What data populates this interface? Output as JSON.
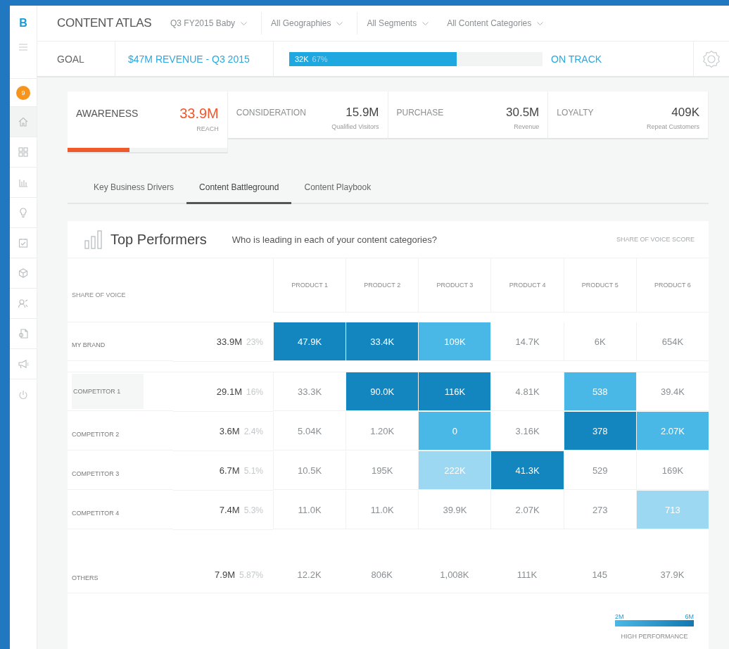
{
  "sidebar": {
    "logo": "B",
    "badge": "9",
    "nav": [
      {
        "selected": true
      },
      {
        "selected": false
      },
      {
        "selected": false
      },
      {
        "selected": false
      },
      {
        "selected": false
      },
      {
        "selected": false
      },
      {
        "selected": false
      },
      {
        "selected": false
      },
      {
        "selected": false
      }
    ]
  },
  "header": {
    "title": "CONTENT ATLAS",
    "filters": [
      {
        "label": "Q3 FY2015 Baby"
      },
      {
        "label": "All Geographies"
      },
      {
        "label": "All Segments"
      },
      {
        "label": "All Content Categories"
      }
    ]
  },
  "goal": {
    "label": "GOAL",
    "target": "$47M REVENUE - Q3 2015",
    "progress_value": "32K",
    "progress_percent": "67%",
    "level": 0.66,
    "status": "ON TRACK"
  },
  "metrics": [
    {
      "name": "AWARENESS",
      "value": "33.9M",
      "caption": "REACH",
      "selected": true,
      "level": 0.39
    },
    {
      "name": "CONSIDERATION",
      "value": "15.9M",
      "caption": "Qualified Visitors",
      "selected": false
    },
    {
      "name": "PURCHASE",
      "value": "30.5M",
      "caption": "Revenue",
      "selected": false
    },
    {
      "name": "LOYALTY",
      "value": "409K",
      "caption": "Repeat Customers",
      "selected": false
    }
  ],
  "tabs": [
    {
      "label": "Key Business Drivers",
      "selected": false
    },
    {
      "label": "Content Battleground",
      "selected": true
    },
    {
      "label": "Content Playbook",
      "selected": false
    }
  ],
  "panel": {
    "title": "Top Performers",
    "question": "Who is leading in each of your content categories?",
    "score_label": "SHARE OF VOICE SCORE"
  },
  "table": {
    "header": "SHARE OF VOICE",
    "columns": [
      "PRODUCT 1",
      "PRODUCT 2",
      "PRODUCT 3",
      "PRODUCT 4",
      "PRODUCT 5",
      "PRODUCT 6"
    ],
    "rows": [
      {
        "name": "MY BRAND",
        "total": "33.9M",
        "share": "23%",
        "selected": false,
        "cells": [
          {
            "value": "47.9K",
            "color": "#1386c0"
          },
          {
            "value": "33.4K",
            "color": "#1386c0"
          },
          {
            "value": "109K",
            "color": "#4ab8e6"
          },
          {
            "value": "14.7K"
          },
          {
            "value": "6K"
          },
          {
            "value": "654K"
          }
        ]
      },
      {
        "name": "COMPETITOR 1",
        "total": "29.1M",
        "share": "16%",
        "selected": true,
        "cells": [
          {
            "value": "33.3K"
          },
          {
            "value": "90.0K",
            "color": "#1386c0"
          },
          {
            "value": "116K",
            "color": "#1386c0"
          },
          {
            "value": "4.81K"
          },
          {
            "value": "538",
            "color": "#4ab8e6"
          },
          {
            "value": "39.4K"
          }
        ]
      },
      {
        "name": "COMPETITOR 2",
        "total": "3.6M",
        "share": "2.4%",
        "selected": false,
        "cells": [
          {
            "value": "5.04K"
          },
          {
            "value": "1.20K"
          },
          {
            "value": "0",
            "color": "#4ab8e6"
          },
          {
            "value": "3.16K"
          },
          {
            "value": "378",
            "color": "#1386c0"
          },
          {
            "value": "2.07K",
            "color": "#4ab8e6"
          }
        ]
      },
      {
        "name": "COMPETITOR 3",
        "total": "6.7M",
        "share": "5.1%",
        "selected": false,
        "cells": [
          {
            "value": "10.5K"
          },
          {
            "value": "195K"
          },
          {
            "value": "222K",
            "color": "#9dd8f2"
          },
          {
            "value": "41.3K",
            "color": "#1386c0"
          },
          {
            "value": "529"
          },
          {
            "value": "169K"
          }
        ]
      },
      {
        "name": "COMPETITOR 4",
        "total": "7.4M",
        "share": "5.3%",
        "selected": false,
        "cells": [
          {
            "value": "11.0K"
          },
          {
            "value": "11.0K"
          },
          {
            "value": "39.9K"
          },
          {
            "value": "2.07K"
          },
          {
            "value": "273"
          },
          {
            "value": "713",
            "color": "#9dd8f2"
          }
        ]
      },
      {
        "name": "OTHERS",
        "total": "7.9M",
        "share": "5.87%",
        "selected": false,
        "cells": [
          {
            "value": "12.2K"
          },
          {
            "value": "806K"
          },
          {
            "value": "1,008K"
          },
          {
            "value": "111K"
          },
          {
            "value": "145"
          },
          {
            "value": "37.9K"
          }
        ]
      }
    ]
  },
  "legend": {
    "min": "2M",
    "max": "6M",
    "label": "HIGH PERFORMANCE"
  }
}
